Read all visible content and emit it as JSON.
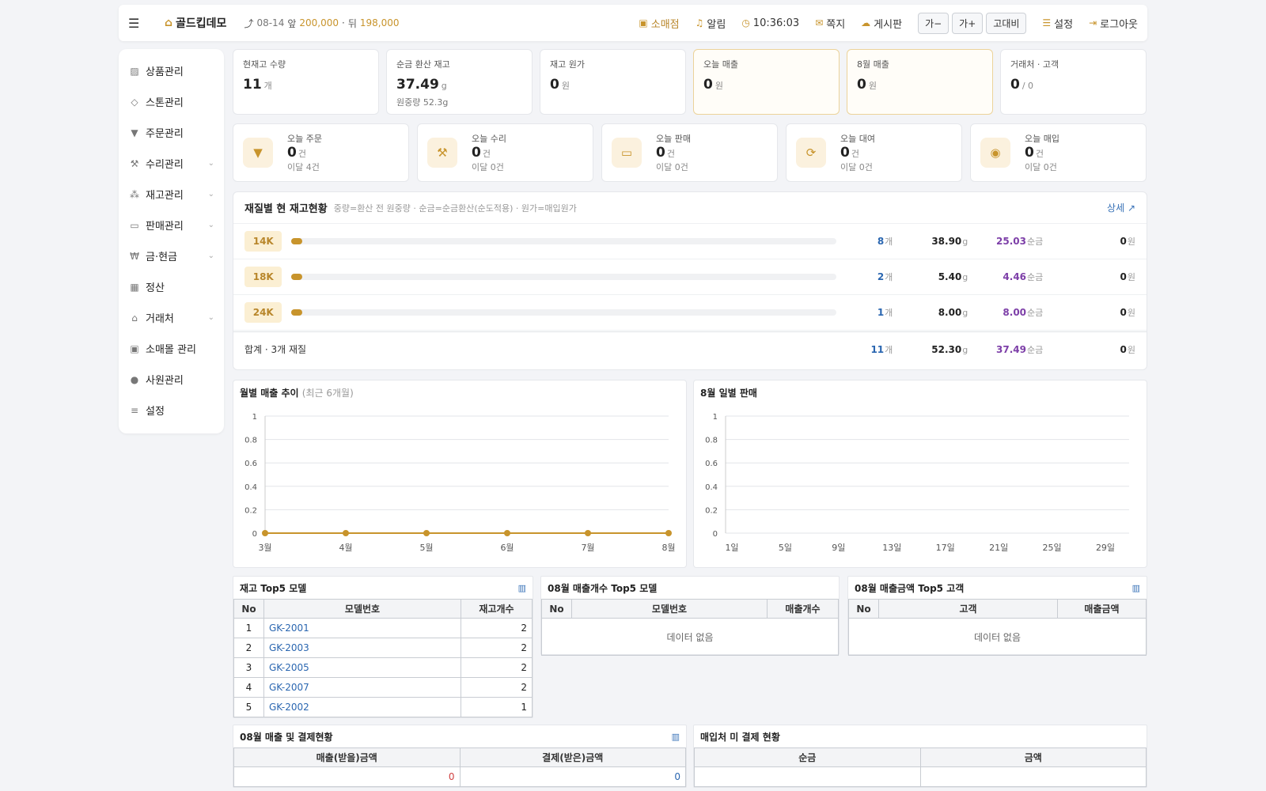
{
  "topbar": {
    "brand": "골드킵데모",
    "ticker_date": "08-14",
    "ticker_front_label": "앞",
    "ticker_front_value": "200,000",
    "ticker_sep": "·",
    "ticker_back_label": "뒤",
    "ticker_back_value": "198,000",
    "shop": "소매점",
    "alerts": "알림",
    "time": "10:36:03",
    "messages": "쪽지",
    "board": "게시판",
    "font_down": "가−",
    "font_up": "가+",
    "contrast": "고대비",
    "settings": "설정",
    "logout": "로그아웃"
  },
  "sidebar": {
    "items": [
      {
        "label": "상품관리",
        "icon": "image-icon"
      },
      {
        "label": "스톤관리",
        "icon": "diamond-icon"
      },
      {
        "label": "주문관리",
        "icon": "cart-icon"
      },
      {
        "label": "수리관리",
        "icon": "wrench-icon"
      },
      {
        "label": "재고관리",
        "icon": "boxes-icon"
      },
      {
        "label": "판매관리",
        "icon": "card-icon"
      },
      {
        "label": "금·현금",
        "icon": "won-icon"
      },
      {
        "label": "정산",
        "icon": "calculator-icon"
      },
      {
        "label": "거래처",
        "icon": "bank-icon"
      },
      {
        "label": "소매몰 관리",
        "icon": "bag-icon"
      },
      {
        "label": "사원관리",
        "icon": "user-icon"
      },
      {
        "label": "설정",
        "icon": "sliders-icon"
      }
    ]
  },
  "stats": [
    {
      "label": "현재고 수량",
      "value": "11",
      "unit": "개",
      "sub": ""
    },
    {
      "label": "순금 환산 재고",
      "value": "37.49",
      "unit": "g",
      "sub": "원중량 52.3g"
    },
    {
      "label": "재고 원가",
      "value": "0",
      "unit": "원",
      "sub": ""
    },
    {
      "label": "오늘 매출",
      "value": "0",
      "unit": "원",
      "sub": ""
    },
    {
      "label": "8월 매출",
      "value": "0",
      "unit": "원",
      "sub": ""
    },
    {
      "label": "거래처 · 고객",
      "value": "0",
      "unit": "/ 0",
      "sub": ""
    }
  ],
  "today": [
    {
      "label": "오늘 주문",
      "value": "0",
      "unit": "건",
      "sub": "이달 4건",
      "icon": "cart-icon"
    },
    {
      "label": "오늘 수리",
      "value": "0",
      "unit": "건",
      "sub": "이달 0건",
      "icon": "wrench-icon"
    },
    {
      "label": "오늘 판매",
      "value": "0",
      "unit": "건",
      "sub": "이달 0건",
      "icon": "card-icon"
    },
    {
      "label": "오늘 대여",
      "value": "0",
      "unit": "건",
      "sub": "이달 0건",
      "icon": "refresh-icon"
    },
    {
      "label": "오늘 매입",
      "value": "0",
      "unit": "건",
      "sub": "이달 0건",
      "icon": "target-icon"
    }
  ],
  "inventory": {
    "title": "재질별 현 재고현황",
    "note": "중량=환산 전 원중량 · 순금=순금환산(순도적용) · 원가=매입원가",
    "detail": "상세 ↗",
    "unit_count": "개",
    "unit_gram": "g",
    "unit_pure": "순금",
    "unit_cost": "원",
    "rows": [
      {
        "material": "14K",
        "fill": 0.02,
        "count": "8",
        "gram": "38.90",
        "pure": "25.03",
        "cost": "0"
      },
      {
        "material": "18K",
        "fill": 0.02,
        "count": "2",
        "gram": "5.40",
        "pure": "4.46",
        "cost": "0"
      },
      {
        "material": "24K",
        "fill": 0.02,
        "count": "1",
        "gram": "8.00",
        "pure": "8.00",
        "cost": "0"
      }
    ],
    "total": {
      "label": "합계 · 3개 재질",
      "count": "11",
      "gram": "52.30",
      "pure": "37.49",
      "cost": "0"
    }
  },
  "chart_data": [
    {
      "type": "line",
      "title": "월별 매출 추이",
      "subtitle": "(최근 6개월)",
      "categories": [
        "3월",
        "4월",
        "5월",
        "6월",
        "7월",
        "8월"
      ],
      "values": [
        0,
        0,
        0,
        0,
        0,
        0
      ],
      "ylim": [
        0,
        1
      ],
      "yticks": [
        "1",
        "0.8",
        "0.6",
        "0.4",
        "0.2",
        "0"
      ],
      "color": "#c8942c"
    },
    {
      "type": "line",
      "title": "8월 일별 판매",
      "subtitle": "",
      "categories": [
        "1일",
        "5일",
        "9일",
        "13일",
        "17일",
        "21일",
        "25일",
        "29일"
      ],
      "values": [],
      "ylim": [
        0,
        1
      ],
      "yticks": [
        "1",
        "0.8",
        "0.6",
        "0.4",
        "0.2",
        "0"
      ],
      "color": "#c8942c"
    }
  ],
  "top_stock": {
    "title": "재고 Top5 모델",
    "headers": [
      "No",
      "모델번호",
      "재고개수"
    ],
    "rows": [
      {
        "no": "1",
        "model": "GK-2001",
        "qty": "2"
      },
      {
        "no": "2",
        "model": "GK-2003",
        "qty": "2"
      },
      {
        "no": "3",
        "model": "GK-2005",
        "qty": "2"
      },
      {
        "no": "4",
        "model": "GK-2007",
        "qty": "2"
      },
      {
        "no": "5",
        "model": "GK-2002",
        "qty": "1"
      }
    ]
  },
  "top_sales_count": {
    "title": "08월 매출개수 Top5 모델",
    "headers": [
      "No",
      "모델번호",
      "매출개수"
    ],
    "empty": "데이터 없음"
  },
  "top_sales_amount": {
    "title": "08월 매출금액 Top5 고객",
    "headers": [
      "No",
      "고객",
      "매출금액"
    ],
    "empty": "데이터 없음"
  },
  "payments": {
    "title": "08월 매출 및 결제현황",
    "headers": [
      "매출(받을)금액",
      "결제(받은)금액"
    ],
    "receivable": "0",
    "received": "0"
  },
  "unpaid": {
    "title": "매입처 미 결제 현황",
    "headers": [
      "순금",
      "금액"
    ]
  },
  "colors": {
    "accent": "#c8942c",
    "link": "#2a66b0",
    "pure": "#7d3fa8"
  }
}
